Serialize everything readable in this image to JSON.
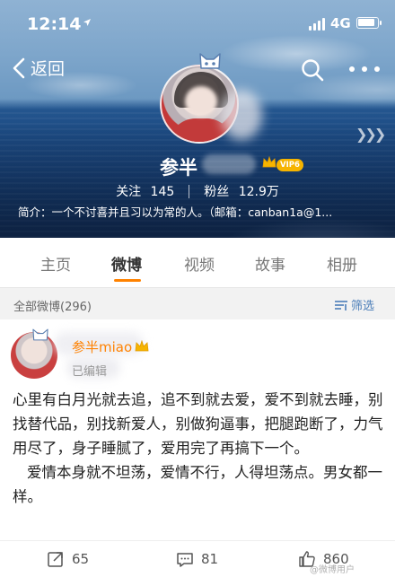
{
  "status_bar": {
    "time": "12:14",
    "network": "4G"
  },
  "header": {
    "back_label": "返回",
    "nickname": "参半",
    "vip_badge": "VIP6",
    "follow_label": "关注",
    "follow_count": "145",
    "fans_label": "粉丝",
    "fans_count": "12.9万",
    "bio": "简介：一个不讨喜并且习以为常的人。（邮箱：canban1a@1..."
  },
  "tabs": [
    {
      "label": "主页",
      "active": false
    },
    {
      "label": "微博",
      "active": true
    },
    {
      "label": "视频",
      "active": false
    },
    {
      "label": "故事",
      "active": false
    },
    {
      "label": "相册",
      "active": false
    }
  ],
  "filter_bar": {
    "all_posts": "全部微博(296)",
    "filter_label": "筛选"
  },
  "post": {
    "author": "参半miao",
    "meta": "已编辑",
    "paragraphs": [
      "心里有白月光就去追，追不到就去爱，爱不到就去睡，别找替代品，别找新爱人，别做狗逼事，把腿跑断了，力气用尽了，身子睡腻了，爱用完了再搞下一个。",
      "爱情本身就不坦荡，爱情不行，人得坦荡点。男女都一样。"
    ],
    "reposts": "65",
    "comments": "81",
    "likes": "860"
  },
  "watermark": "@微博用户",
  "colors": {
    "accent_orange": "#ff8200",
    "link_blue": "#4a7db8",
    "vip_gold": "#f6b400"
  }
}
